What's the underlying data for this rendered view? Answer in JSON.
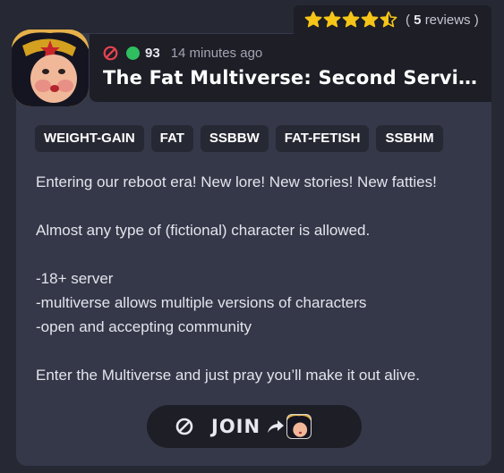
{
  "rating": {
    "stars": 4.5,
    "star_color": "#f5c518",
    "reviews_count": "5",
    "reviews_open": "(",
    "reviews_word": "reviews )"
  },
  "server": {
    "nsfw_icon": "ban-icon",
    "online_count": "93",
    "online_color": "#2fbf5f",
    "time_ago": "14 minutes ago",
    "title": "The Fat Multiverse: Second Serving"
  },
  "tags": [
    "WEIGHT-GAIN",
    "FAT",
    "SSBBW",
    "FAT-FETISH",
    "SSBHM"
  ],
  "description": [
    "Entering our reboot era! New lore! New stories! New fatties!",
    "",
    "Almost any type of (fictional) character is allowed.",
    "",
    "-18+ server",
    "-multiverse allows multiple versions of characters",
    "-open and accepting community",
    "",
    "Enter the Multiverse and just pray you’ll make it out alive."
  ],
  "join": {
    "label": "JOIN",
    "icon": "ban-icon",
    "arrow_icon": "arrow-icon"
  }
}
